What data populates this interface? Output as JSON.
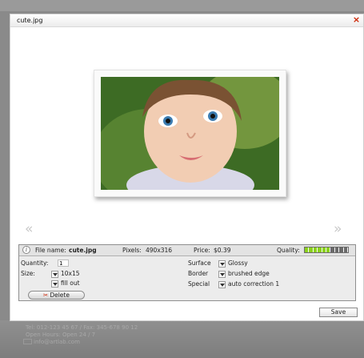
{
  "dialog": {
    "title": "cute.jpg",
    "close_symbol": "×"
  },
  "nav": {
    "prev_symbol": "«",
    "next_symbol": "»"
  },
  "info": {
    "file_name_label": "File name:",
    "file_name": "cute.jpg",
    "pixels_label": "Pixels:",
    "pixels": "490x316",
    "price_label": "Price:",
    "price": "$0.39",
    "quality_label": "Quality:",
    "quality_level": 0.6,
    "quality_segments": 10,
    "quality_color_on": "#8bd11e",
    "quality_color_off": "#6a6a6a"
  },
  "options": {
    "quantity_label": "Quantity:",
    "quantity_value": "1",
    "size_label": "Size:",
    "size_value": "10x15",
    "fill_value": "fill out",
    "surface_label": "Surface",
    "surface_value": "Glossy",
    "border_label": "Border",
    "border_value": "brushed edge",
    "special_label": "Special",
    "special_value": "auto correction 1",
    "delete_label": "Delete"
  },
  "footer": {
    "save_label": "Save",
    "line1": "Tel: 012-123 45 67 / Fax: 345-678 90 12",
    "line2": "Open Hours: Open 24 / 7",
    "email": "info@artlab.com"
  }
}
